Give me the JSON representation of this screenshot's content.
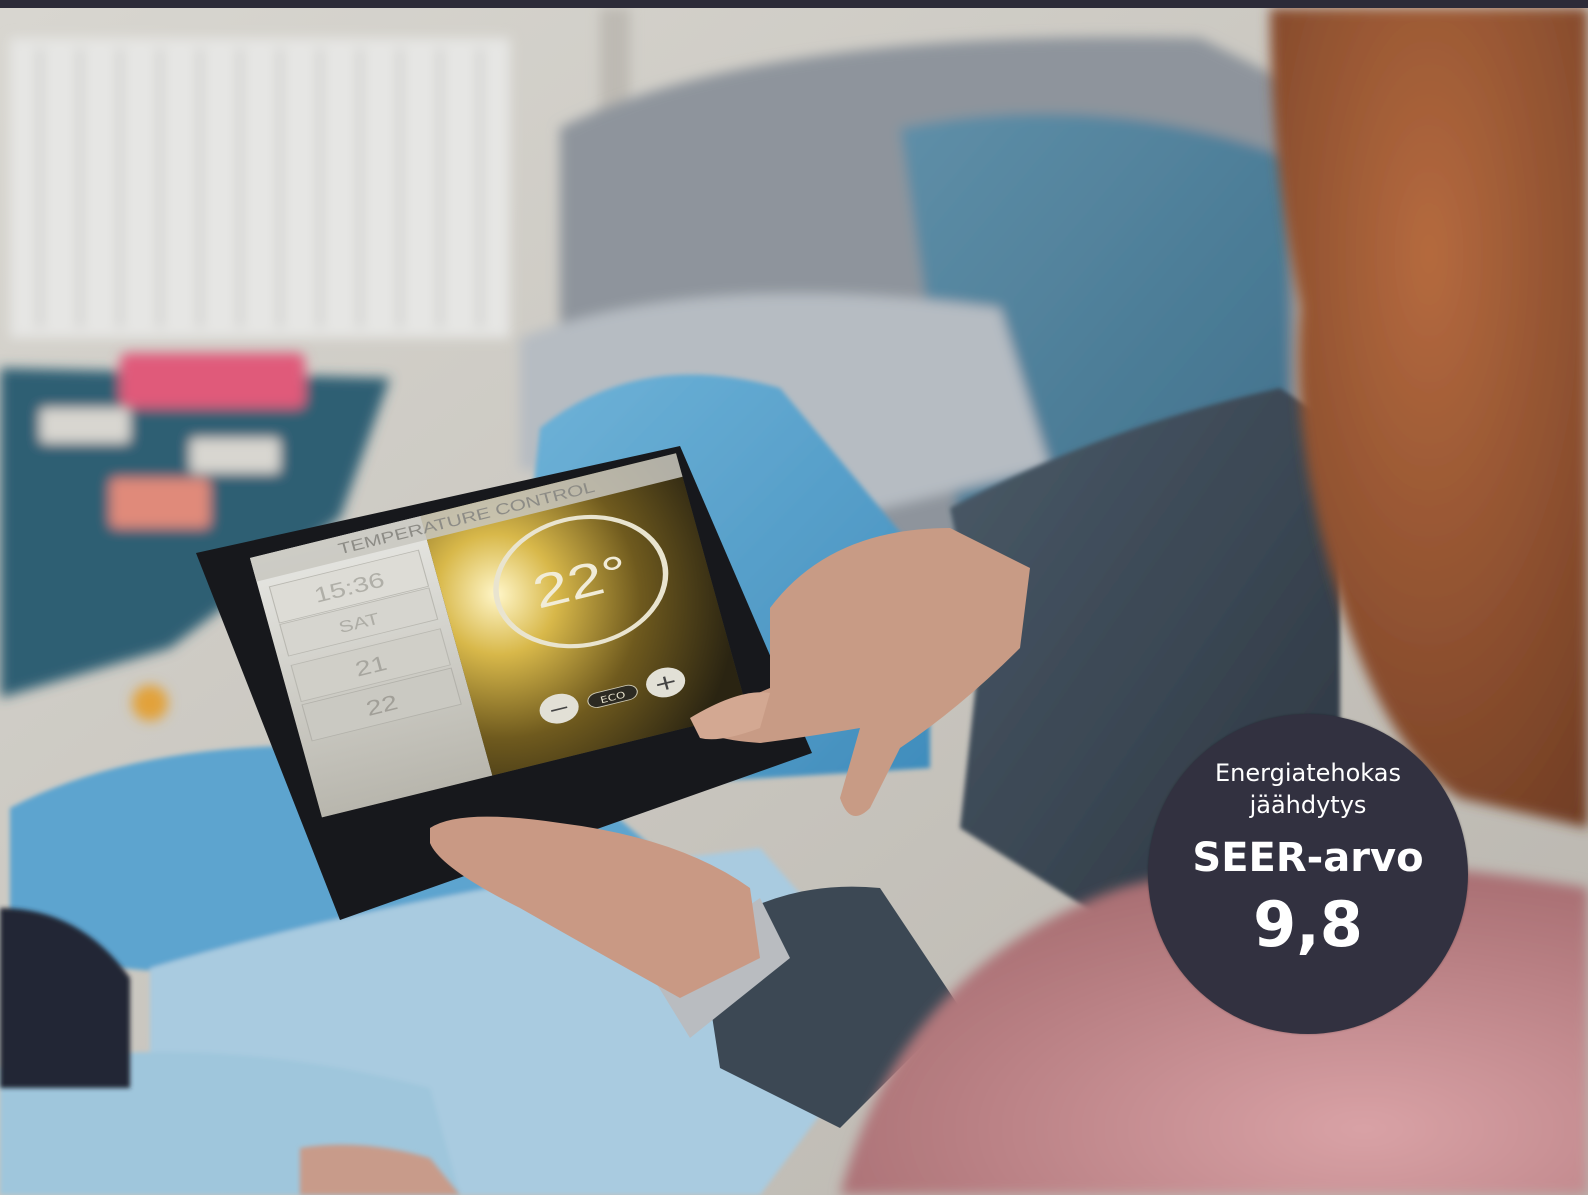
{
  "tablet_screen": {
    "header": "TEMPERATURE CONTROL",
    "time": "15:36",
    "day": "SAT",
    "value_a": "21",
    "value_b": "22",
    "temperature": "22°",
    "minus_label": "−",
    "plus_label": "+",
    "eco_label": "ECO"
  },
  "badge": {
    "line1": "Energiatehokas",
    "line2": "jäähdytys",
    "line3": "SEER-arvo",
    "value": "9,8"
  },
  "colors": {
    "top_bar": "#2c2b38",
    "badge_bg": "#323140",
    "badge_text": "#ffffff"
  }
}
